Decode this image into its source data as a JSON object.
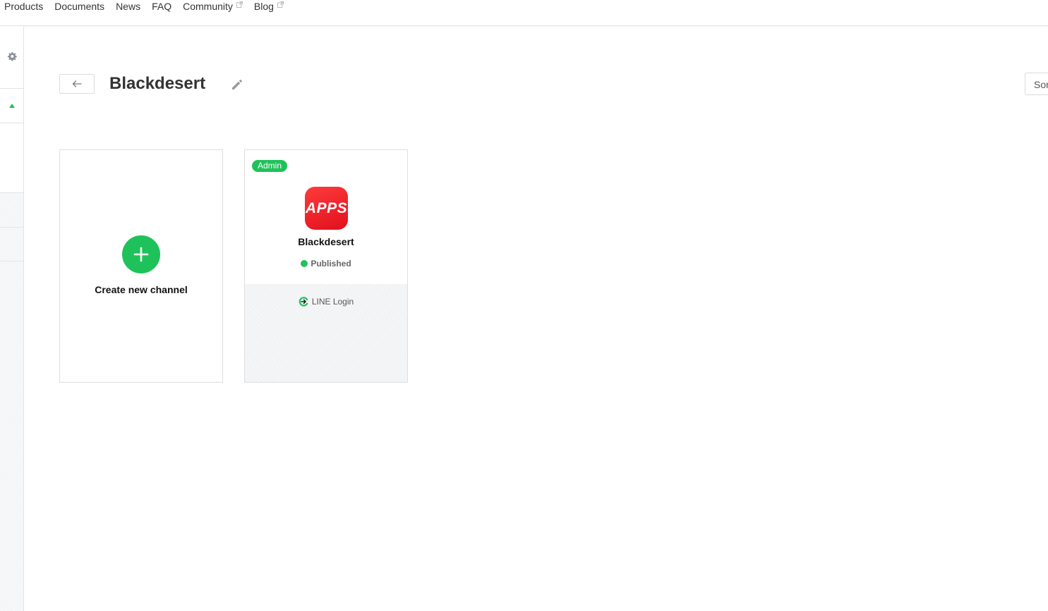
{
  "nav": {
    "items": [
      {
        "label": "Products",
        "external": false
      },
      {
        "label": "Documents",
        "external": false
      },
      {
        "label": "News",
        "external": false
      },
      {
        "label": "FAQ",
        "external": false
      },
      {
        "label": "Community",
        "external": true
      },
      {
        "label": "Blog",
        "external": true
      }
    ]
  },
  "sidebar": {
    "icons": [
      "gear-icon",
      "caret-up-icon"
    ]
  },
  "header": {
    "title": "Blackdesert",
    "sort_label": "Sort"
  },
  "create_card": {
    "label": "Create new channel"
  },
  "channel_card": {
    "badge": "Admin",
    "icon_text": "APPS",
    "name": "Blackdesert",
    "status": "Published",
    "product": "LINE Login"
  },
  "colors": {
    "accent_green": "#1fc25a",
    "app_icon_red": "#e0101e"
  }
}
